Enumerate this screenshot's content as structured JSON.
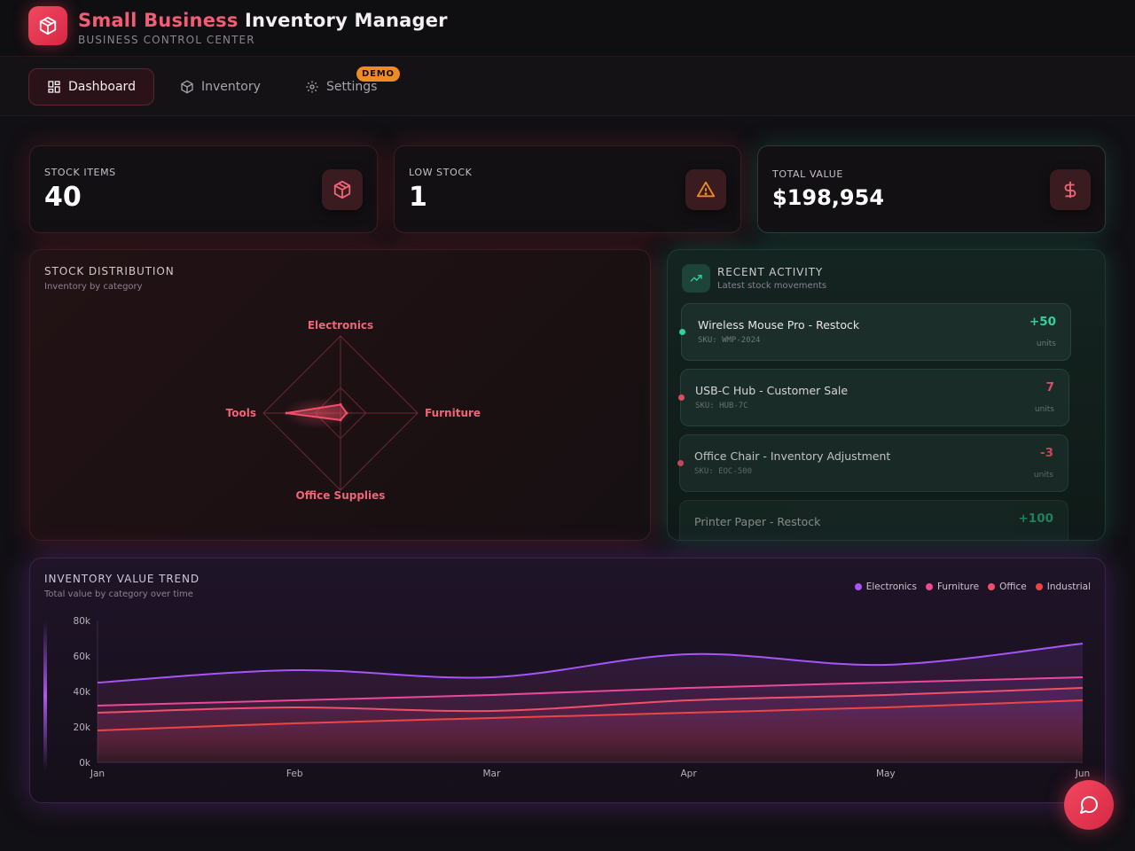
{
  "app": {
    "title_accent": "Small Business",
    "title_rest": "Inventory Manager",
    "subtitle": "BUSINESS CONTROL CENTER",
    "logo_icon": "package-icon"
  },
  "nav": {
    "tabs": [
      {
        "label": "Dashboard",
        "icon": "dashboard-grid-icon",
        "active": true
      },
      {
        "label": "Inventory",
        "icon": "package-icon",
        "active": false
      },
      {
        "label": "Settings",
        "icon": "gear-icon",
        "active": false,
        "badge": "DEMO"
      }
    ]
  },
  "stats": [
    {
      "label": "STOCK ITEMS",
      "value": "40",
      "icon": "package-icon"
    },
    {
      "label": "LOW STOCK",
      "value": "1",
      "icon": "warning-triangle-icon"
    },
    {
      "label": "TOTAL VALUE",
      "value": "$198,954",
      "icon": "dollar-icon"
    }
  ],
  "distribution": {
    "title": "STOCK DISTRIBUTION",
    "subtitle": "Inventory by category",
    "categories": [
      "Electronics",
      "Furniture",
      "Office Supplies",
      "Tools"
    ]
  },
  "activity": {
    "title": "RECENT ACTIVITY",
    "subtitle": "Latest stock movements",
    "icon": "trending-up-icon",
    "items": [
      {
        "name": "Wireless Mouse Pro - Restock",
        "sku": "SKU: WMP-2024",
        "qty": "+50",
        "unit": "units",
        "color": "#2fd39a"
      },
      {
        "name": "USB-C Hub - Customer Sale",
        "sku": "SKU: HUB-7C",
        "qty": "7",
        "unit": "units",
        "color": "#f0506a"
      },
      {
        "name": "Office Chair - Inventory Adjustment",
        "sku": "SKU: EOC-500",
        "qty": "-3",
        "unit": "units",
        "color": "#f0506a"
      },
      {
        "name": "Printer Paper - Restock",
        "sku": "",
        "qty": "+100",
        "unit": "",
        "color": "#2fd39a"
      }
    ]
  },
  "trend": {
    "title": "INVENTORY VALUE TREND",
    "subtitle": "Total value by category over time"
  },
  "chat": {
    "icon": "chat-bubble-icon"
  },
  "chart_data": [
    {
      "type": "radar",
      "categories": [
        "Electronics",
        "Furniture",
        "Office Supplies",
        "Tools"
      ],
      "values": [
        0.11,
        0.08,
        0.09,
        0.7
      ],
      "color": "#f0506a"
    },
    {
      "type": "area",
      "categories": [
        "Jan",
        "Feb",
        "Mar",
        "Apr",
        "May",
        "Jun"
      ],
      "ylim": [
        0,
        80000
      ],
      "yticks": [
        "0k",
        "20k",
        "40k",
        "60k",
        "80k"
      ],
      "series": [
        {
          "name": "Electronics",
          "color": "#a855f7",
          "values": [
            45000,
            52000,
            48000,
            61000,
            55000,
            67000
          ]
        },
        {
          "name": "Furniture",
          "color": "#ec4899",
          "values": [
            32000,
            35000,
            38000,
            42000,
            45000,
            48000
          ]
        },
        {
          "name": "Office",
          "color": "#f0506a",
          "values": [
            28000,
            31000,
            29000,
            35000,
            38000,
            42000
          ]
        },
        {
          "name": "Industrial",
          "color": "#ef4444",
          "values": [
            18000,
            22000,
            25000,
            28000,
            31000,
            35000
          ]
        }
      ]
    }
  ]
}
